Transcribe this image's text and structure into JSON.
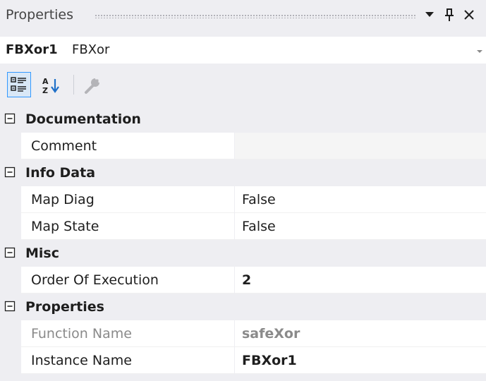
{
  "window": {
    "title": "Properties"
  },
  "object_selector": {
    "name": "FBXor1",
    "type": "FBXor"
  },
  "toolbar": {
    "categorized_icon": "categorized-view-icon",
    "alphabetical_icon": "alphabetical-sort-icon",
    "property_pages_icon": "wrench-icon",
    "categorized_active": true
  },
  "categories": [
    {
      "label": "Documentation",
      "properties": [
        {
          "name": "Comment",
          "value": ""
        }
      ]
    },
    {
      "label": "Info Data",
      "properties": [
        {
          "name": "Map Diag",
          "value": "False"
        },
        {
          "name": "Map State",
          "value": "False"
        }
      ]
    },
    {
      "label": "Misc",
      "properties": [
        {
          "name": "Order Of Execution",
          "value": "2"
        }
      ]
    },
    {
      "label": "Properties",
      "properties": [
        {
          "name": "Function Name",
          "value": "safeXor"
        },
        {
          "name": "Instance Name",
          "value": "FBXor1"
        }
      ]
    }
  ],
  "colors": {
    "background": "#eeeef2",
    "accent": "#3399ff",
    "readonly_text": "#8a8a8a"
  }
}
